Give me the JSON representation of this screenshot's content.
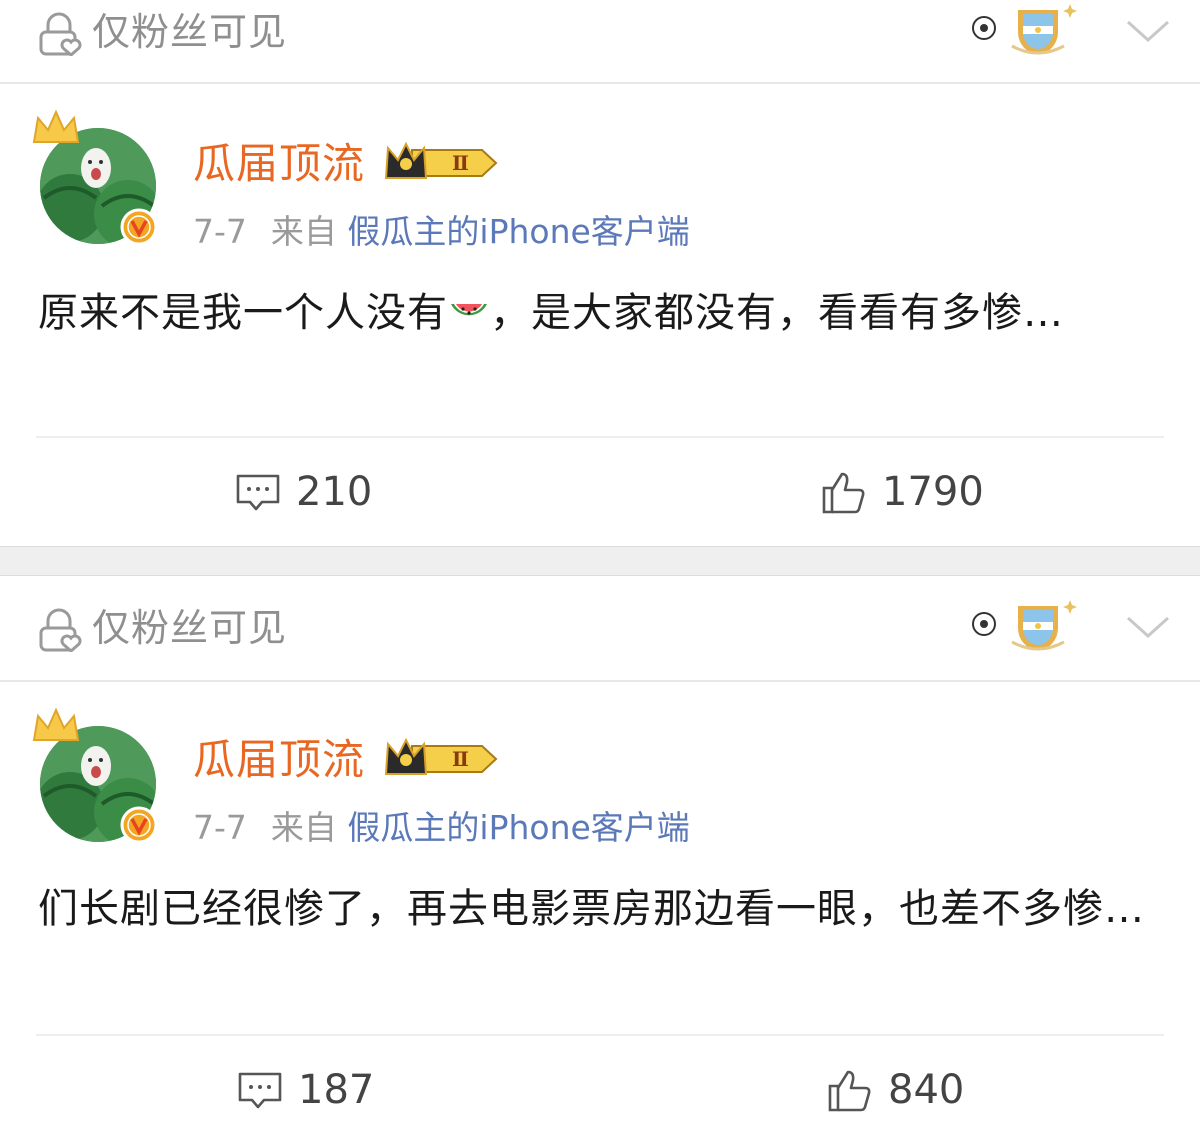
{
  "posts": [
    {
      "visibility_label": "仅粉丝可见",
      "username": "瓜届顶流",
      "vip_level": "Ⅱ",
      "date": "7-7",
      "source_prefix": "来自",
      "source": "假瓜主的iPhone客户端",
      "text_before_emoji": "原来不是我一个人没有",
      "text_after_emoji": "，是大家都没有，看看有多惨…",
      "comments": "210",
      "likes": "1790"
    },
    {
      "visibility_label": "仅粉丝可见",
      "username": "瓜届顶流",
      "vip_level": "Ⅱ",
      "date": "7-7",
      "source_prefix": "来自",
      "source": "假瓜主的iPhone客户端",
      "text": "们长剧已经很惨了，再去电影票房那边看一眼，也差不多惨…",
      "comments": "187",
      "likes": "840"
    }
  ],
  "colors": {
    "username": "#e86722",
    "source_link": "#5b78b8",
    "muted_text": "#8f8f8f",
    "body_text": "#1a1a1a"
  },
  "icons": [
    "lock-heart-icon",
    "football-fan-badge-icon",
    "chevron-down-icon",
    "crown-icon",
    "verified-v-icon",
    "vip-crown-icon",
    "watermelon-emoji-icon",
    "comment-icon",
    "thumbs-up-icon"
  ]
}
